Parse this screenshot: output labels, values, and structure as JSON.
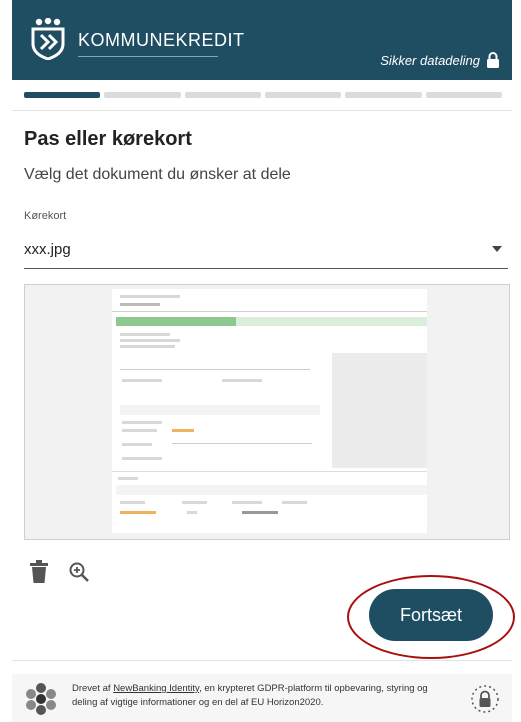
{
  "header": {
    "brand": "KOMMUNEKREDIT",
    "secure_label": "Sikker datadeling"
  },
  "progress": {
    "current_step": 1,
    "total_steps": 6
  },
  "main": {
    "title": "Pas eller kørekort",
    "subtitle": "Vælg det dokument du ønsker at dele",
    "document_select": {
      "label": "Kørekort",
      "value": "xxx.jpg"
    }
  },
  "actions": {
    "continue_label": "Fortsæt"
  },
  "footer": {
    "text_prefix": "Drevet af ",
    "link": "NewBanking Identity",
    "text_suffix": ", en krypteret GDPR-platform til opbevaring, styring og deling af vigtige informationer og en del af EU Horizon2020."
  },
  "icons": [
    "kommunekredit-logo-icon",
    "lock-icon",
    "trash-icon",
    "zoom-in-icon",
    "newbanking-logo-icon",
    "padlock-icon"
  ],
  "colors": {
    "primary": "#1f4e63",
    "highlight_ring": "#a80f0f"
  }
}
